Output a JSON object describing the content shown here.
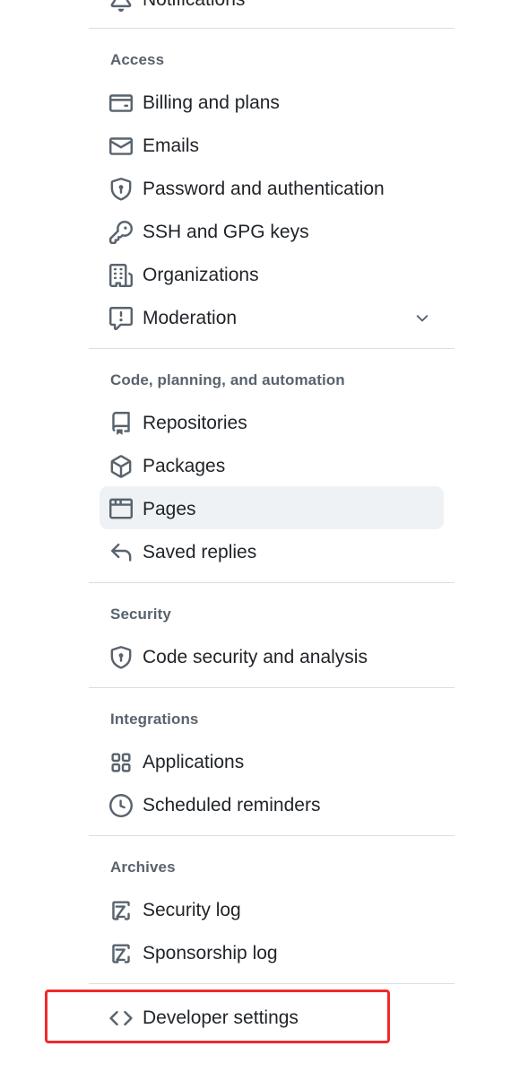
{
  "top_partial_item": {
    "label": "Notifications",
    "icon": "bell-icon"
  },
  "sections": [
    {
      "title": "Access",
      "items": [
        {
          "label": "Billing and plans",
          "icon": "credit-card-icon"
        },
        {
          "label": "Emails",
          "icon": "mail-icon"
        },
        {
          "label": "Password and authentication",
          "icon": "shield-lock-icon"
        },
        {
          "label": "SSH and GPG keys",
          "icon": "key-icon"
        },
        {
          "label": "Organizations",
          "icon": "organization-icon"
        },
        {
          "label": "Moderation",
          "icon": "report-icon",
          "expandable": true
        }
      ]
    },
    {
      "title": "Code, planning, and automation",
      "items": [
        {
          "label": "Repositories",
          "icon": "repo-icon"
        },
        {
          "label": "Packages",
          "icon": "package-icon"
        },
        {
          "label": "Pages",
          "icon": "browser-icon",
          "selected": true
        },
        {
          "label": "Saved replies",
          "icon": "reply-icon"
        }
      ]
    },
    {
      "title": "Security",
      "items": [
        {
          "label": "Code security and analysis",
          "icon": "shield-lock-icon"
        }
      ]
    },
    {
      "title": "Integrations",
      "items": [
        {
          "label": "Applications",
          "icon": "apps-icon"
        },
        {
          "label": "Scheduled reminders",
          "icon": "clock-icon"
        }
      ]
    },
    {
      "title": "Archives",
      "items": [
        {
          "label": "Security log",
          "icon": "log-icon"
        },
        {
          "label": "Sponsorship log",
          "icon": "log-icon"
        }
      ]
    }
  ],
  "developer_settings": {
    "label": "Developer settings",
    "icon": "code-icon"
  },
  "colors": {
    "highlight": "#ee2b2b",
    "selected_bg": "#eff2f5",
    "divider": "#d8dee4",
    "section_title": "#59636e"
  }
}
